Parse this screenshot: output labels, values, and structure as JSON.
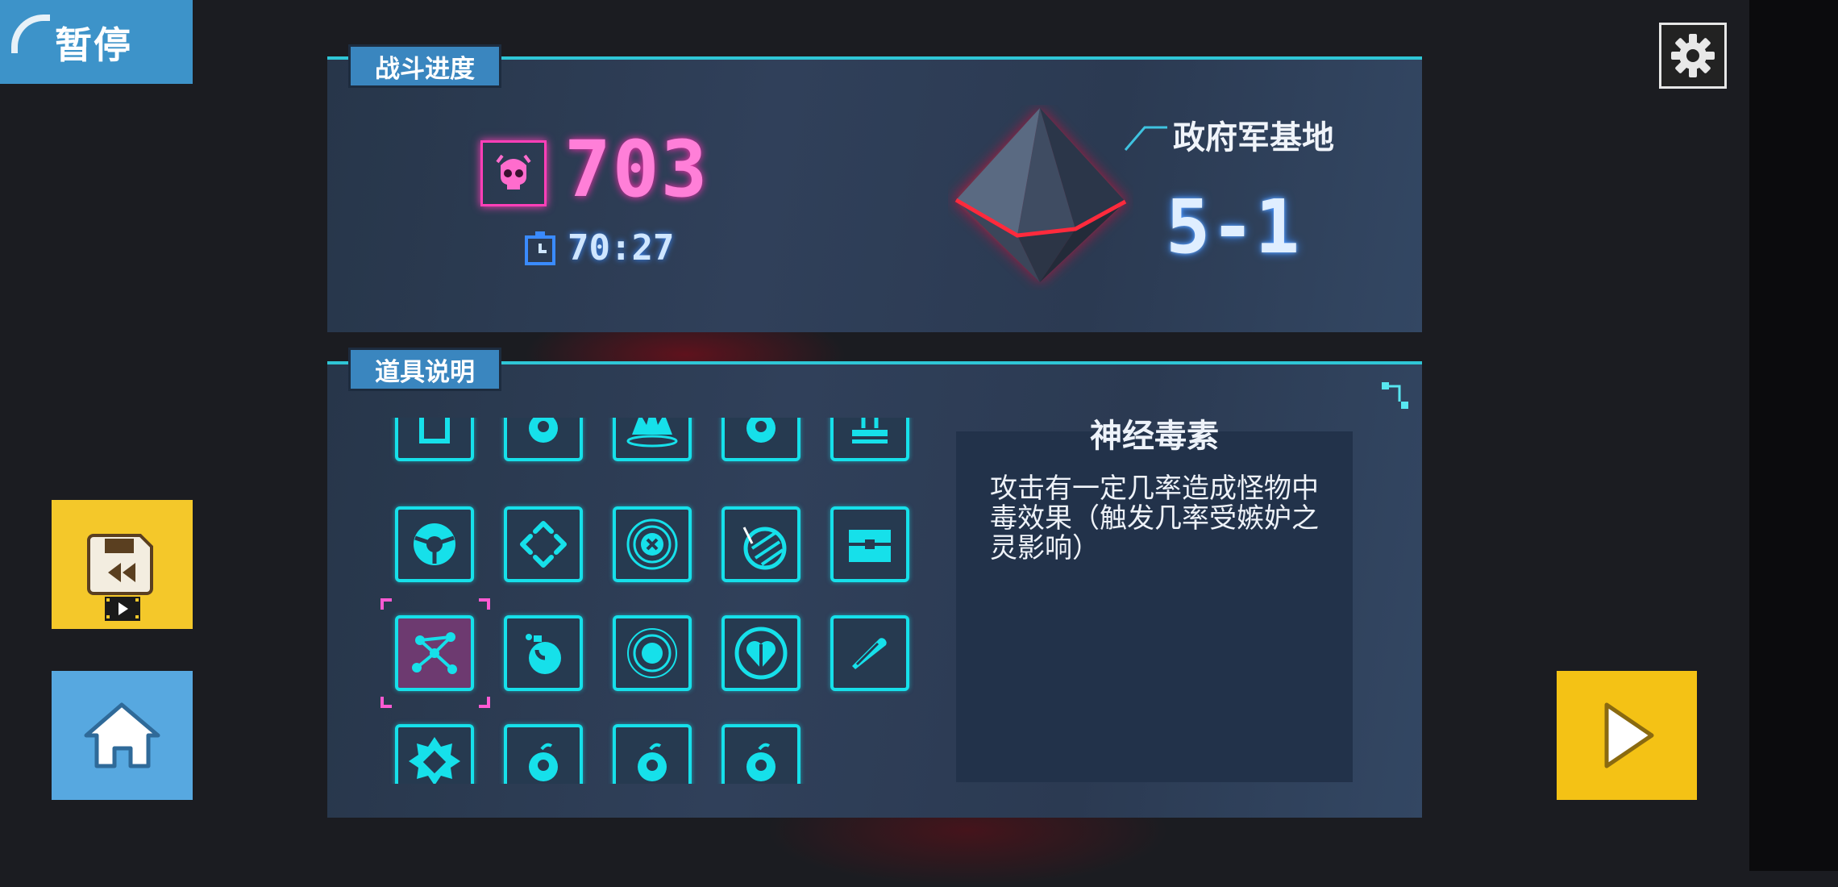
{
  "pause": {
    "label": "暂停"
  },
  "battle_progress": {
    "tab_label": "战斗进度",
    "kills": "703",
    "time": "70:27",
    "location": "政府军基地",
    "stage": "5-1"
  },
  "items_panel": {
    "tab_label": "道具说明",
    "selected": {
      "name": "神经毒素",
      "description": "攻击有一定几率造成怪物中毒效果（触发几率受嫉妒之灵影响）"
    },
    "items": [
      "armor-item-icon",
      "bomb-item-icon",
      "flame-item-icon",
      "bomb-eye-item-icon",
      "stamp-item-icon",
      "radiation-item-icon",
      "diamond-arrows-item-icon",
      "cross-circle-item-icon",
      "striped-ball-item-icon",
      "chest-item-icon",
      "neural-network-item-icon",
      "potion-item-icon",
      "target-ring-item-icon",
      "heart-shield-item-icon",
      "pen-item-icon",
      "spiky-gem-item-icon",
      "bomb-eye-item-icon",
      "bomb-eye-item-icon",
      "bomb-eye-item-icon"
    ]
  },
  "colors": {
    "accent_cyan": "#16e0ea",
    "kill_pink": "#ff3fb8",
    "button_yellow": "#f4c82a",
    "button_blue": "#57a8e0"
  }
}
